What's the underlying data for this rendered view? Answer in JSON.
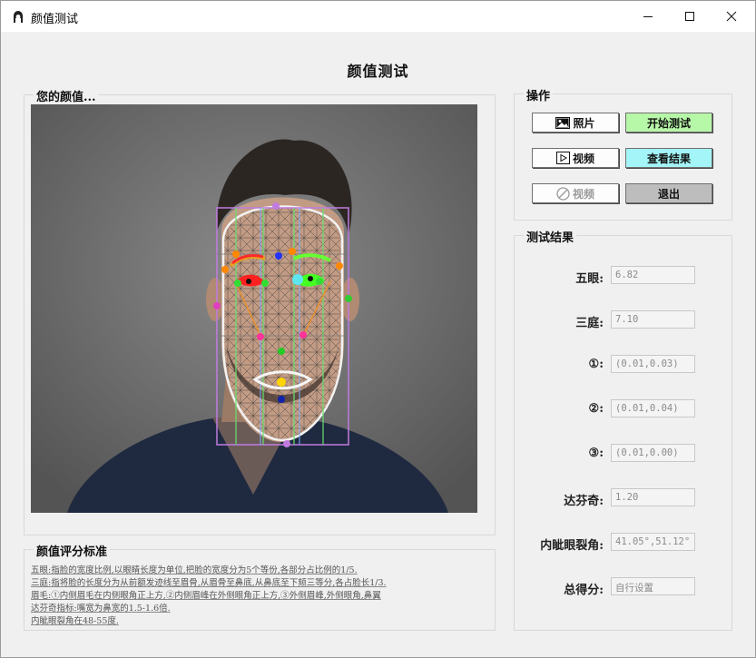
{
  "window": {
    "title": "颜值测试"
  },
  "window_controls": {
    "minimize": "—",
    "maximize": "☐",
    "close": "✕"
  },
  "page": {
    "title": "颜值测试"
  },
  "photo_panel": {
    "legend": "您的颜值..."
  },
  "operations": {
    "legend": "操作",
    "photo_button": "照片",
    "start_button": "开始测试",
    "video_button": "视频",
    "view_results_button": "查看结果",
    "camera_button": "视频",
    "exit_button": "退出"
  },
  "results": {
    "legend": "测试结果",
    "items": [
      {
        "label": "五眼:",
        "value": "6.82"
      },
      {
        "label": "三庭:",
        "value": "7.10"
      },
      {
        "label": "①:",
        "value": "(0.01,0.03)"
      },
      {
        "label": "②:",
        "value": "(0.01,0.04)"
      },
      {
        "label": "③:",
        "value": "(0.01,0.00)"
      },
      {
        "label": "达芬奇:",
        "value": "1.20"
      },
      {
        "label": "内眦眼裂角:",
        "value": "41.05°,51.12°"
      },
      {
        "label": "总得分:",
        "value": "自行设置"
      }
    ]
  },
  "standards": {
    "legend": "颜值评分标准",
    "lines": [
      "五眼:指脸的宽度比例,以眼睛长度为单位,把脸的宽度分为5个等份,各部分占比例的1/5.",
      "三庭:指将脸的长度分为从前额发迹线至眉骨,从眉骨至鼻底,从鼻底至下颏三等分,各占脸长1/3.",
      "眉毛:①内侧眉毛在内侧眼角正上方,②内侧眉峰在外侧眼角正上方,③外侧眉峰,外侧眼角,鼻翼",
      "达芬奇指标:嘴宽为鼻宽的1.5-1.6倍.",
      "内眦眼裂角在48-55度."
    ]
  },
  "colors": {
    "start_button_bg": "#b7f7a8",
    "view_results_button_bg": "#a3f5f7",
    "exit_button_bg": "#bdbdbd",
    "photo_bg": "#6b6b6b"
  },
  "icons": {
    "app": "person-icon",
    "photo_button": "image-icon",
    "video_button": "play-icon",
    "camera_button": "no-video-icon"
  }
}
